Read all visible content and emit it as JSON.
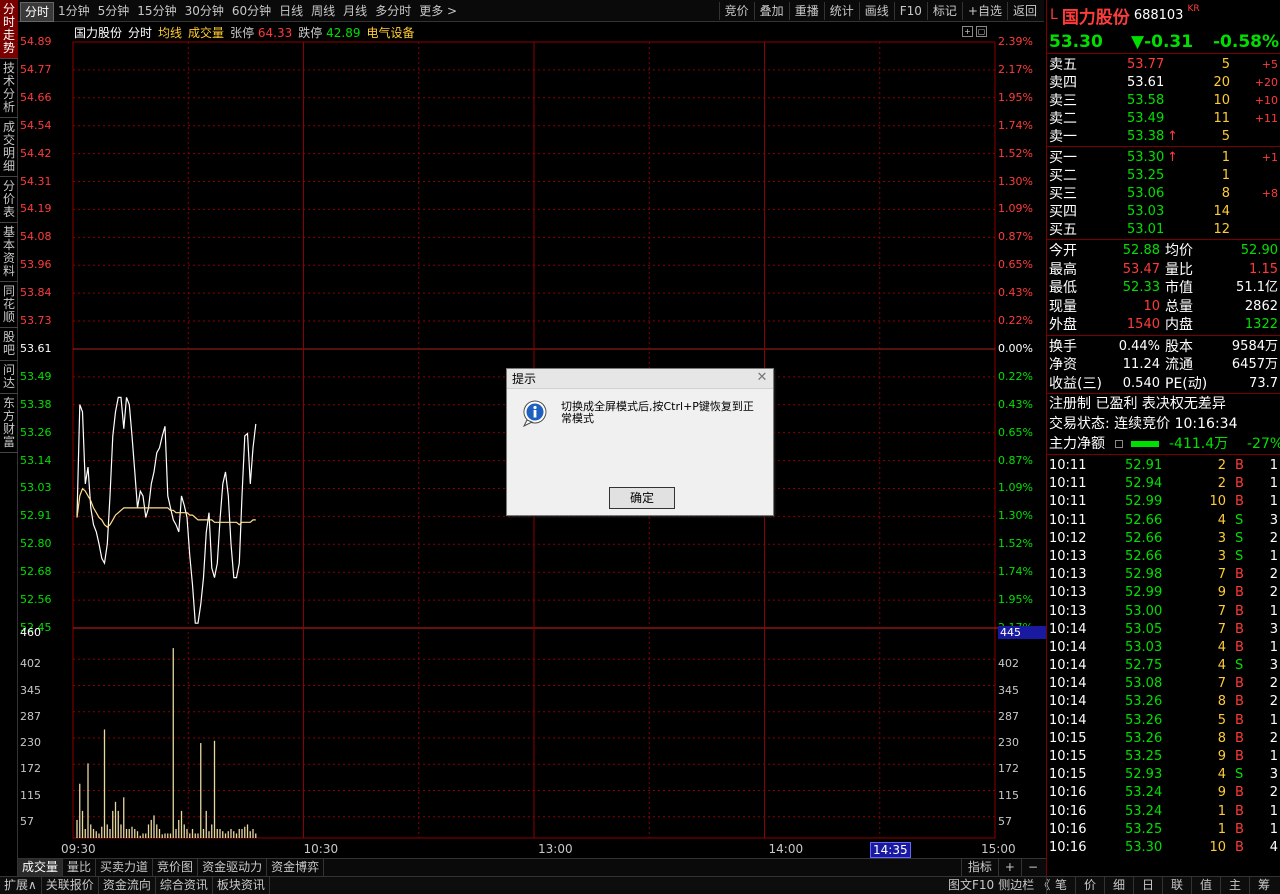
{
  "left_tabs": [
    "分时走势",
    "技术分析",
    "成交明细",
    "分价表",
    "基本资料",
    "同花顺",
    "股吧",
    "问达",
    "东方财富"
  ],
  "toolbar": {
    "periods": [
      "分时",
      "1分钟",
      "5分钟",
      "15分钟",
      "30分钟",
      "60分钟",
      "日线",
      "周线",
      "月线",
      "多分时",
      "更多 >"
    ],
    "right": [
      "竞价",
      "叠加",
      "重播",
      "统计",
      "画线",
      "F10",
      "标记",
      "+自选",
      "返回"
    ]
  },
  "chart": {
    "info": {
      "name": "国力股份",
      "mode": "分时",
      "avg": "均线",
      "vol": "成交量",
      "limit_up_label": "张停",
      "limit_up": "64.33",
      "limit_down_label": "跌停",
      "limit_down": "42.89",
      "sector": "电气设备"
    },
    "price_labels_left": [
      "54.89",
      "54.77",
      "54.66",
      "54.54",
      "54.42",
      "54.31",
      "54.19",
      "54.08",
      "53.96",
      "53.84",
      "53.73",
      "53.61",
      "53.49",
      "53.38",
      "53.26",
      "53.14",
      "53.03",
      "52.91",
      "52.80",
      "52.68",
      "52.56",
      "52.45"
    ],
    "pct_labels_right": [
      "2.39%",
      "2.17%",
      "1.95%",
      "1.74%",
      "1.52%",
      "1.30%",
      "1.09%",
      "0.87%",
      "0.65%",
      "0.43%",
      "0.22%",
      "0.00%",
      "0.22%",
      "0.43%",
      "0.65%",
      "0.87%",
      "1.09%",
      "1.30%",
      "1.52%",
      "1.74%",
      "1.95%",
      "2.17%"
    ],
    "vol_labels_left": [
      "460",
      "402",
      "345",
      "287",
      "230",
      "172",
      "115",
      "57"
    ],
    "vol_labels_right": [
      "445",
      "402",
      "345",
      "287",
      "230",
      "172",
      "115",
      "57"
    ],
    "time_labels": [
      "09:30",
      "10:30",
      "13:00",
      "14:00",
      "15:00"
    ],
    "cursor_time": "14:35"
  },
  "chart_data": {
    "type": "line",
    "prev_close": 53.61,
    "price_range": [
      52.45,
      54.89
    ],
    "price": [
      52.91,
      53.38,
      53.35,
      53.05,
      53.12,
      52.95,
      52.88,
      52.85,
      52.8,
      52.74,
      52.72,
      52.8,
      53.0,
      53.25,
      53.35,
      53.41,
      53.41,
      53.28,
      53.41,
      53.38,
      53.25,
      53.1,
      52.95,
      53.02,
      53.0,
      52.91,
      52.95,
      53.05,
      53.1,
      53.18,
      53.2,
      53.25,
      53.29,
      53.0,
      52.95,
      52.9,
      52.88,
      52.85,
      53.0,
      52.96,
      52.91,
      52.75,
      52.63,
      52.47,
      52.47,
      52.55,
      52.66,
      52.85,
      52.93,
      52.7,
      52.66,
      52.72,
      52.9,
      53.05,
      53.1,
      53.0,
      52.8,
      52.66,
      52.66,
      52.72,
      53.0,
      53.25,
      53.26,
      53.05,
      53.2,
      53.3
    ],
    "avg_price": [
      52.91,
      53.0,
      53.03,
      53.02,
      53.0,
      52.98,
      52.95,
      52.93,
      52.91,
      52.9,
      52.88,
      52.87,
      52.88,
      52.9,
      52.92,
      52.93,
      52.94,
      52.95,
      52.95,
      52.95,
      52.95,
      52.95,
      52.95,
      52.95,
      52.95,
      52.95,
      52.95,
      52.95,
      52.95,
      52.95,
      52.95,
      52.95,
      52.95,
      52.95,
      52.94,
      52.94,
      52.93,
      52.93,
      52.93,
      52.93,
      52.93,
      52.92,
      52.92,
      52.91,
      52.9,
      52.9,
      52.9,
      52.9,
      52.9,
      52.9,
      52.89,
      52.89,
      52.89,
      52.89,
      52.89,
      52.89,
      52.89,
      52.89,
      52.89,
      52.88,
      52.89,
      52.89,
      52.89,
      52.89,
      52.9,
      52.9
    ],
    "volume": [
      40,
      120,
      60,
      20,
      165,
      30,
      20,
      15,
      10,
      25,
      240,
      30,
      20,
      60,
      80,
      60,
      30,
      90,
      20,
      20,
      25,
      20,
      15,
      5,
      10,
      10,
      30,
      40,
      50,
      30,
      20,
      8,
      10,
      10,
      10,
      420,
      20,
      40,
      60,
      30,
      20,
      10,
      20,
      10,
      10,
      210,
      20,
      60,
      15,
      30,
      215,
      20,
      20,
      15,
      10,
      15,
      20,
      15,
      10,
      20,
      20,
      25,
      30,
      15,
      20,
      10
    ],
    "volume_range": [
      0,
      460
    ],
    "xlabel": "",
    "ylabel": ""
  },
  "bottom_tabs": [
    "成交量",
    "量比",
    "买卖力道",
    "竞价图",
    "资金驱动力",
    "资金博弈"
  ],
  "bottom_right": [
    "指标",
    "+",
    "−"
  ],
  "status_bar": {
    "left": [
      "扩展∧",
      "关联报价",
      "资金流向",
      "综合资讯",
      "板块资讯"
    ],
    "right": [
      "图文F10",
      "侧边栏",
      "《"
    ],
    "panel_tabs": [
      "笔",
      "价",
      "细",
      "日",
      "联",
      "值",
      "主",
      "筹"
    ]
  },
  "stock": {
    "flag": "L",
    "name": "国力股份",
    "code": "688103",
    "badge": "KR",
    "price": "53.30",
    "change": "▼-0.31",
    "change_pct": "-0.58%"
  },
  "sell_book": [
    {
      "label": "卖五",
      "price": "53.77",
      "vol": "5",
      "delta": "+5"
    },
    {
      "label": "卖四",
      "price": "53.61",
      "vol": "20",
      "delta": "+20"
    },
    {
      "label": "卖三",
      "price": "53.58",
      "vol": "10",
      "delta": "+10"
    },
    {
      "label": "卖二",
      "price": "53.49",
      "vol": "11",
      "delta": "+11"
    },
    {
      "label": "卖一",
      "price": "53.38",
      "vol": "5",
      "delta": ""
    }
  ],
  "buy_book": [
    {
      "label": "买一",
      "price": "53.30",
      "vol": "1",
      "delta": "+1"
    },
    {
      "label": "买二",
      "price": "53.25",
      "vol": "1",
      "delta": ""
    },
    {
      "label": "买三",
      "price": "53.06",
      "vol": "8",
      "delta": "+8"
    },
    {
      "label": "买四",
      "price": "53.03",
      "vol": "14",
      "delta": ""
    },
    {
      "label": "买五",
      "price": "53.01",
      "vol": "12",
      "delta": ""
    }
  ],
  "stats": [
    {
      "l1": "今开",
      "v1": "52.88",
      "l2": "均价",
      "v2": "52.90"
    },
    {
      "l1": "最高",
      "v1": "53.47",
      "l2": "量比",
      "v2": "1.15"
    },
    {
      "l1": "最低",
      "v1": "52.33",
      "l2": "市值",
      "v2": "51.1亿"
    },
    {
      "l1": "现量",
      "v1": "10",
      "l2": "总量",
      "v2": "2862"
    },
    {
      "l1": "外盘",
      "v1": "1540",
      "l2": "内盘",
      "v2": "1322"
    }
  ],
  "stats2": [
    {
      "l1": "换手",
      "v1": "0.44%",
      "l2": "股本",
      "v2": "9584万"
    },
    {
      "l1": "净资",
      "v1": "11.24",
      "l2": "流通",
      "v2": "6457万"
    },
    {
      "l1": "收益(三)",
      "v1": "0.540",
      "l2": "PE(动)",
      "v2": "73.7"
    }
  ],
  "tags": "注册制 已盈利 表决权无差异",
  "trade_status": "交易状态: 连续竞价 10:16:34",
  "main_flow": {
    "label": "主力净额",
    "value": "-411.4万",
    "pct": "-27%"
  },
  "trades": [
    {
      "t": "10:11",
      "p": "52.91",
      "v": "2",
      "d": "B",
      "n": "1"
    },
    {
      "t": "10:11",
      "p": "52.94",
      "v": "2",
      "d": "B",
      "n": "1"
    },
    {
      "t": "10:11",
      "p": "52.99",
      "v": "10",
      "d": "B",
      "n": "1"
    },
    {
      "t": "10:11",
      "p": "52.66",
      "v": "4",
      "d": "S",
      "n": "3"
    },
    {
      "t": "10:12",
      "p": "52.66",
      "v": "3",
      "d": "S",
      "n": "2"
    },
    {
      "t": "10:13",
      "p": "52.66",
      "v": "3",
      "d": "S",
      "n": "1"
    },
    {
      "t": "10:13",
      "p": "52.98",
      "v": "7",
      "d": "B",
      "n": "2"
    },
    {
      "t": "10:13",
      "p": "52.99",
      "v": "9",
      "d": "B",
      "n": "2"
    },
    {
      "t": "10:13",
      "p": "53.00",
      "v": "7",
      "d": "B",
      "n": "1"
    },
    {
      "t": "10:14",
      "p": "53.05",
      "v": "7",
      "d": "B",
      "n": "3"
    },
    {
      "t": "10:14",
      "p": "53.03",
      "v": "4",
      "d": "B",
      "n": "1"
    },
    {
      "t": "10:14",
      "p": "52.75",
      "v": "4",
      "d": "S",
      "n": "3"
    },
    {
      "t": "10:14",
      "p": "53.08",
      "v": "7",
      "d": "B",
      "n": "2"
    },
    {
      "t": "10:14",
      "p": "53.26",
      "v": "8",
      "d": "B",
      "n": "2"
    },
    {
      "t": "10:14",
      "p": "53.26",
      "v": "5",
      "d": "B",
      "n": "1"
    },
    {
      "t": "10:15",
      "p": "53.26",
      "v": "8",
      "d": "B",
      "n": "2"
    },
    {
      "t": "10:15",
      "p": "53.25",
      "v": "9",
      "d": "B",
      "n": "1"
    },
    {
      "t": "10:15",
      "p": "52.93",
      "v": "4",
      "d": "S",
      "n": "3"
    },
    {
      "t": "10:16",
      "p": "53.24",
      "v": "9",
      "d": "B",
      "n": "2"
    },
    {
      "t": "10:16",
      "p": "53.24",
      "v": "1",
      "d": "B",
      "n": "1"
    },
    {
      "t": "10:16",
      "p": "53.25",
      "v": "1",
      "d": "B",
      "n": "1"
    },
    {
      "t": "10:16",
      "p": "53.30",
      "v": "10",
      "d": "B",
      "n": "4"
    }
  ],
  "dialog": {
    "title": "提示",
    "message": "切换成全屏模式后,按Ctrl+P键恢复到正常模式",
    "ok": "确定"
  },
  "colors": {
    "up": "#ff3b3b",
    "down": "#00e000",
    "grid": "#8b0000",
    "price_line": "#ffffff",
    "avg_line": "#ffe08a",
    "volume_bar": "#e8d8a0"
  }
}
